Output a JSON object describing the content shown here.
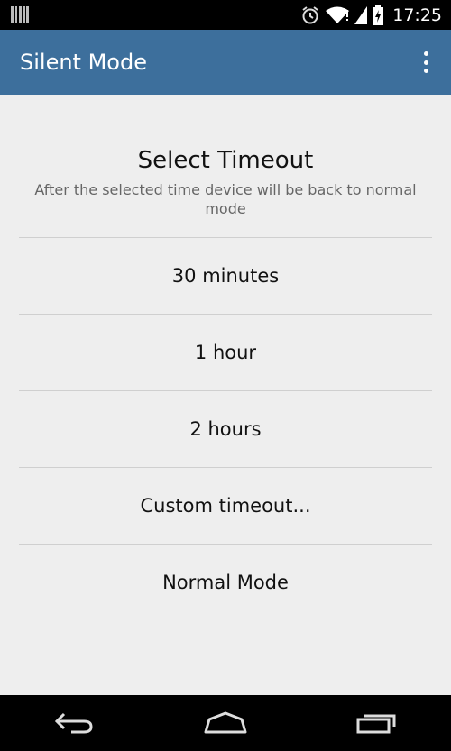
{
  "status_bar": {
    "time": "17:25",
    "icons": [
      "barcode-icon",
      "alarm-icon",
      "wifi-icon",
      "battery-charging-icon"
    ]
  },
  "app_bar": {
    "title": "Silent Mode",
    "menu_icon": "overflow-menu-icon"
  },
  "dialog": {
    "title": "Select Timeout",
    "subtitle": "After the selected time device will be back to normal mode",
    "options": [
      {
        "label": "30 minutes"
      },
      {
        "label": "1 hour"
      },
      {
        "label": "2 hours"
      },
      {
        "label": "Custom timeout..."
      },
      {
        "label": "Normal Mode"
      }
    ]
  },
  "nav_bar": {
    "icons": [
      "back-icon",
      "home-icon",
      "recents-icon"
    ]
  },
  "colors": {
    "app_bar": "#3d6f9c",
    "background": "#eeeeee",
    "divider": "#cfcfcf"
  }
}
